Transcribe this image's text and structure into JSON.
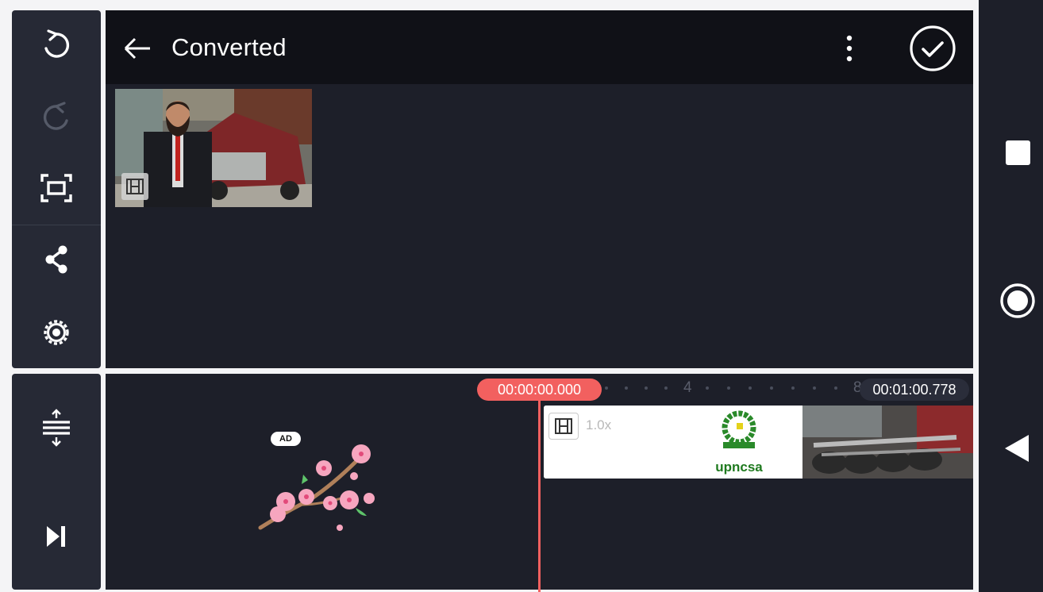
{
  "header": {
    "title": "Converted"
  },
  "timeline": {
    "current_time": "00:00:00.000",
    "duration": "00:01:00.778",
    "ruler_label_4": "4",
    "ruler_label_8": "8"
  },
  "clip": {
    "speed": "1.0x",
    "logo_text": "upncsa"
  },
  "ad": {
    "badge": "AD"
  },
  "colors": {
    "accent": "#f2605f",
    "panel": "#262935",
    "background": "#1d1f29",
    "header": "#101117"
  },
  "icons": {
    "left_toolbar": [
      "undo-icon",
      "redo-icon",
      "fullscreen-icon",
      "share-icon",
      "settings-icon"
    ],
    "left_toolbar_bottom": [
      "expand-timeline-icon",
      "skip-to-end-icon"
    ],
    "header": [
      "back-arrow-icon",
      "more-vert-icon",
      "confirm-check-icon"
    ],
    "nav": [
      "recents-square-icon",
      "home-circle-icon",
      "back-triangle-icon"
    ]
  }
}
